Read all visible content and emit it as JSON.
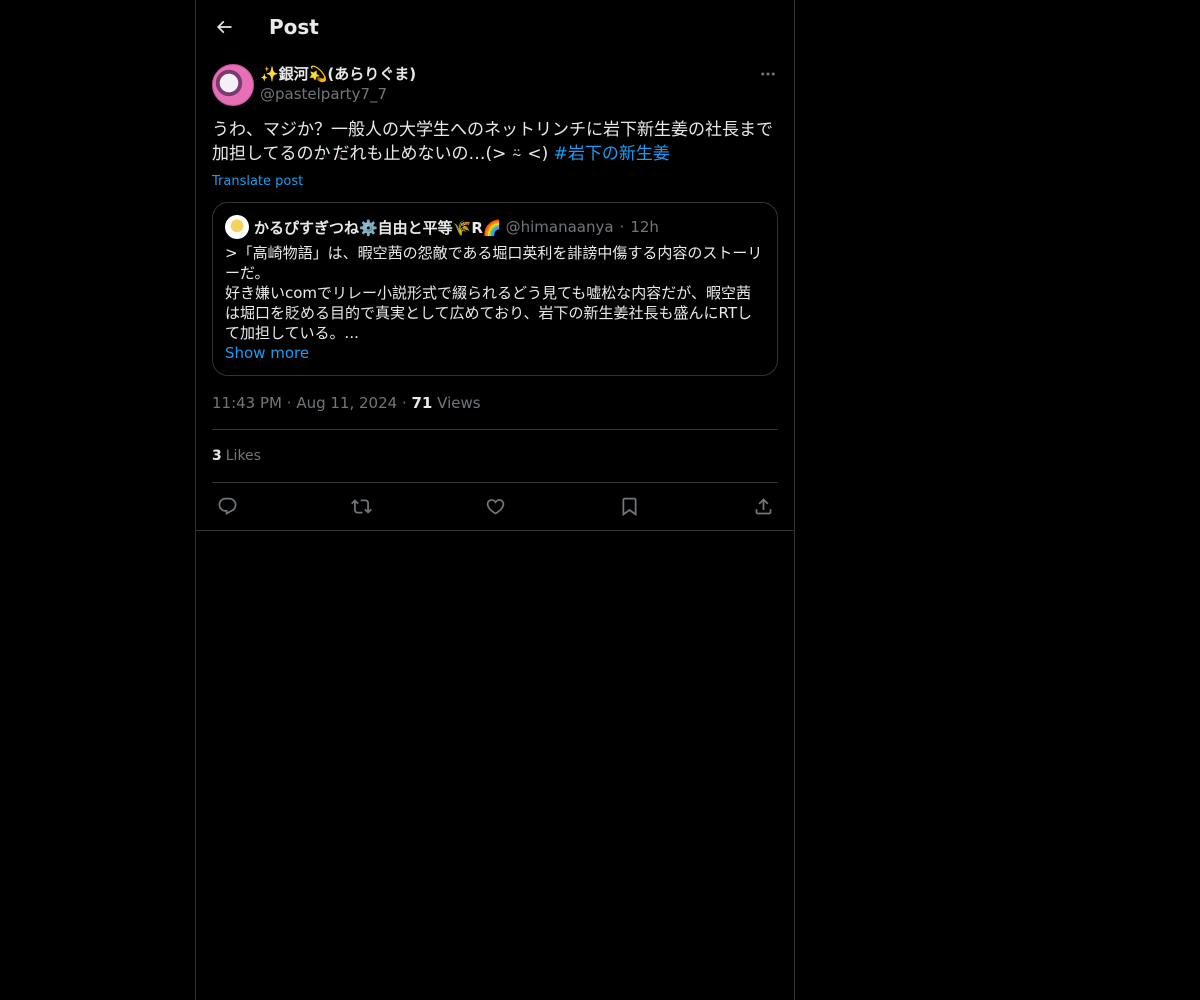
{
  "header": {
    "title": "Post"
  },
  "post": {
    "author_name": "✨銀河💫(あらりぐま)",
    "author_handle": "@pastelparty7_7",
    "text_part1": "うわ、マジか？一般人の大学生へのネットリンチに岩下新生姜の社長まで加担してるのか",
    "text_part2": "だれも止めないの…(> ⍨ <)",
    "hashtag": "#岩下の新生姜",
    "translate_label": "Translate post",
    "time": "11:43 PM",
    "date": "Aug 11, 2024",
    "views_count": "71",
    "views_label": "Views",
    "likes_count": "3",
    "likes_label": "Likes"
  },
  "quote": {
    "author_name": "かるぴすぎつね⚙️自由と平等🌾R🌈",
    "author_handle": "@himanaanya",
    "time": "12h",
    "text_line1": ">「高崎物語」は、暇空茜の怨敵である堀口英利を誹謗中傷する内容のストーリーだ。",
    "text_line2": "好き嫌いcomでリレー小説形式で綴られるどう見ても嘘松な内容だが、暇空茜は堀口を貶める目的で真実として広めており、岩下の新生姜社長も盛んにRTして加担している。...",
    "show_more": "Show more"
  },
  "colors": {
    "background": "#000000",
    "text": "#e7e9ea",
    "secondary": "#71767b",
    "accent": "#1d9bf0",
    "border": "#2f3336"
  },
  "icons": {
    "back": "arrow-left-icon",
    "more": "more-horizontal-icon",
    "reply": "reply-icon",
    "repost": "repost-icon",
    "like": "heart-icon",
    "bookmark": "bookmark-icon",
    "share": "share-icon"
  }
}
